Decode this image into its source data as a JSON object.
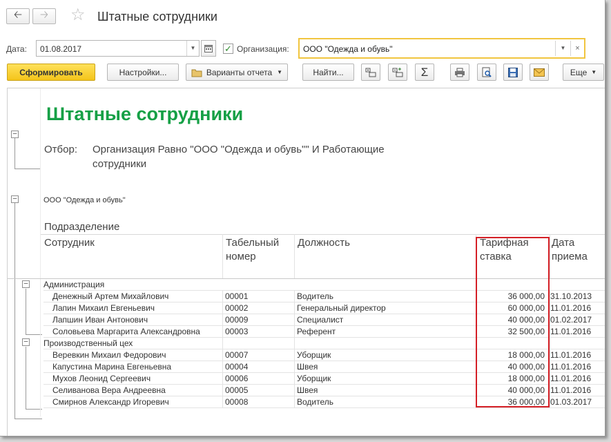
{
  "window": {
    "title": "Штатные сотрудники"
  },
  "filters": {
    "date_label": "Дата:",
    "date_value": "01.08.2017",
    "org_label": "Организация:",
    "org_value": "ООО \"Одежда и обувь\""
  },
  "toolbar": {
    "generate": "Сформировать",
    "settings": "Настройки...",
    "variants": "Варианты отчета",
    "find": "Найти...",
    "more": "Еще"
  },
  "report": {
    "title": "Штатные сотрудники",
    "filter_key": "Отбор:",
    "filter_value": "Организация Равно \"ООО \"Одежда и обувь\"\" И Работающие сотрудники",
    "org": "ООО \"Одежда и обувь\"",
    "headers": {
      "department": "Подразделение",
      "employee": "Сотрудник",
      "tab_number": "Табельный номер",
      "position": "Должность",
      "rate": "Тарифная ставка",
      "hire_date": "Дата приема"
    },
    "groups": [
      {
        "name": "Администрация",
        "rows": [
          {
            "name": "Денежный Артем Михайлович",
            "num": "00001",
            "position": "Водитель",
            "rate": "36 000,00",
            "date": "31.10.2013"
          },
          {
            "name": "Лапин Михаил Евгеньевич",
            "num": "00002",
            "position": "Генеральный директор",
            "rate": "60 000,00",
            "date": "11.01.2016"
          },
          {
            "name": "Лапшин Иван Антонович",
            "num": "00009",
            "position": "Специалист",
            "rate": "40 000,00",
            "date": "01.02.2017"
          },
          {
            "name": "Соловьева Маргарита Александровна",
            "num": "00003",
            "position": "Референт",
            "rate": "32 500,00",
            "date": "11.01.2016"
          }
        ]
      },
      {
        "name": "Производственный цех",
        "rows": [
          {
            "name": "Веревкин Михаил Федорович",
            "num": "00007",
            "position": "Уборщик",
            "rate": "18 000,00",
            "date": "11.01.2016"
          },
          {
            "name": "Капустина Марина Евгеньевна",
            "num": "00004",
            "position": "Швея",
            "rate": "40 000,00",
            "date": "11.01.2016"
          },
          {
            "name": "Мухов Леонид Сергеевич",
            "num": "00006",
            "position": "Уборщик",
            "rate": "18 000,00",
            "date": "11.01.2016"
          },
          {
            "name": "Селиванова Вера Андреевна",
            "num": "00005",
            "position": "Швея",
            "rate": "40 000,00",
            "date": "11.01.2016"
          },
          {
            "name": "Смирнов Александр Игоревич",
            "num": "00008",
            "position": "Водитель",
            "rate": "36 000,00",
            "date": "01.03.2017"
          }
        ]
      }
    ]
  },
  "colors": {
    "accent_yellow": "#f4c41a",
    "title_green": "#16a046",
    "highlight_red": "#d41f26"
  }
}
